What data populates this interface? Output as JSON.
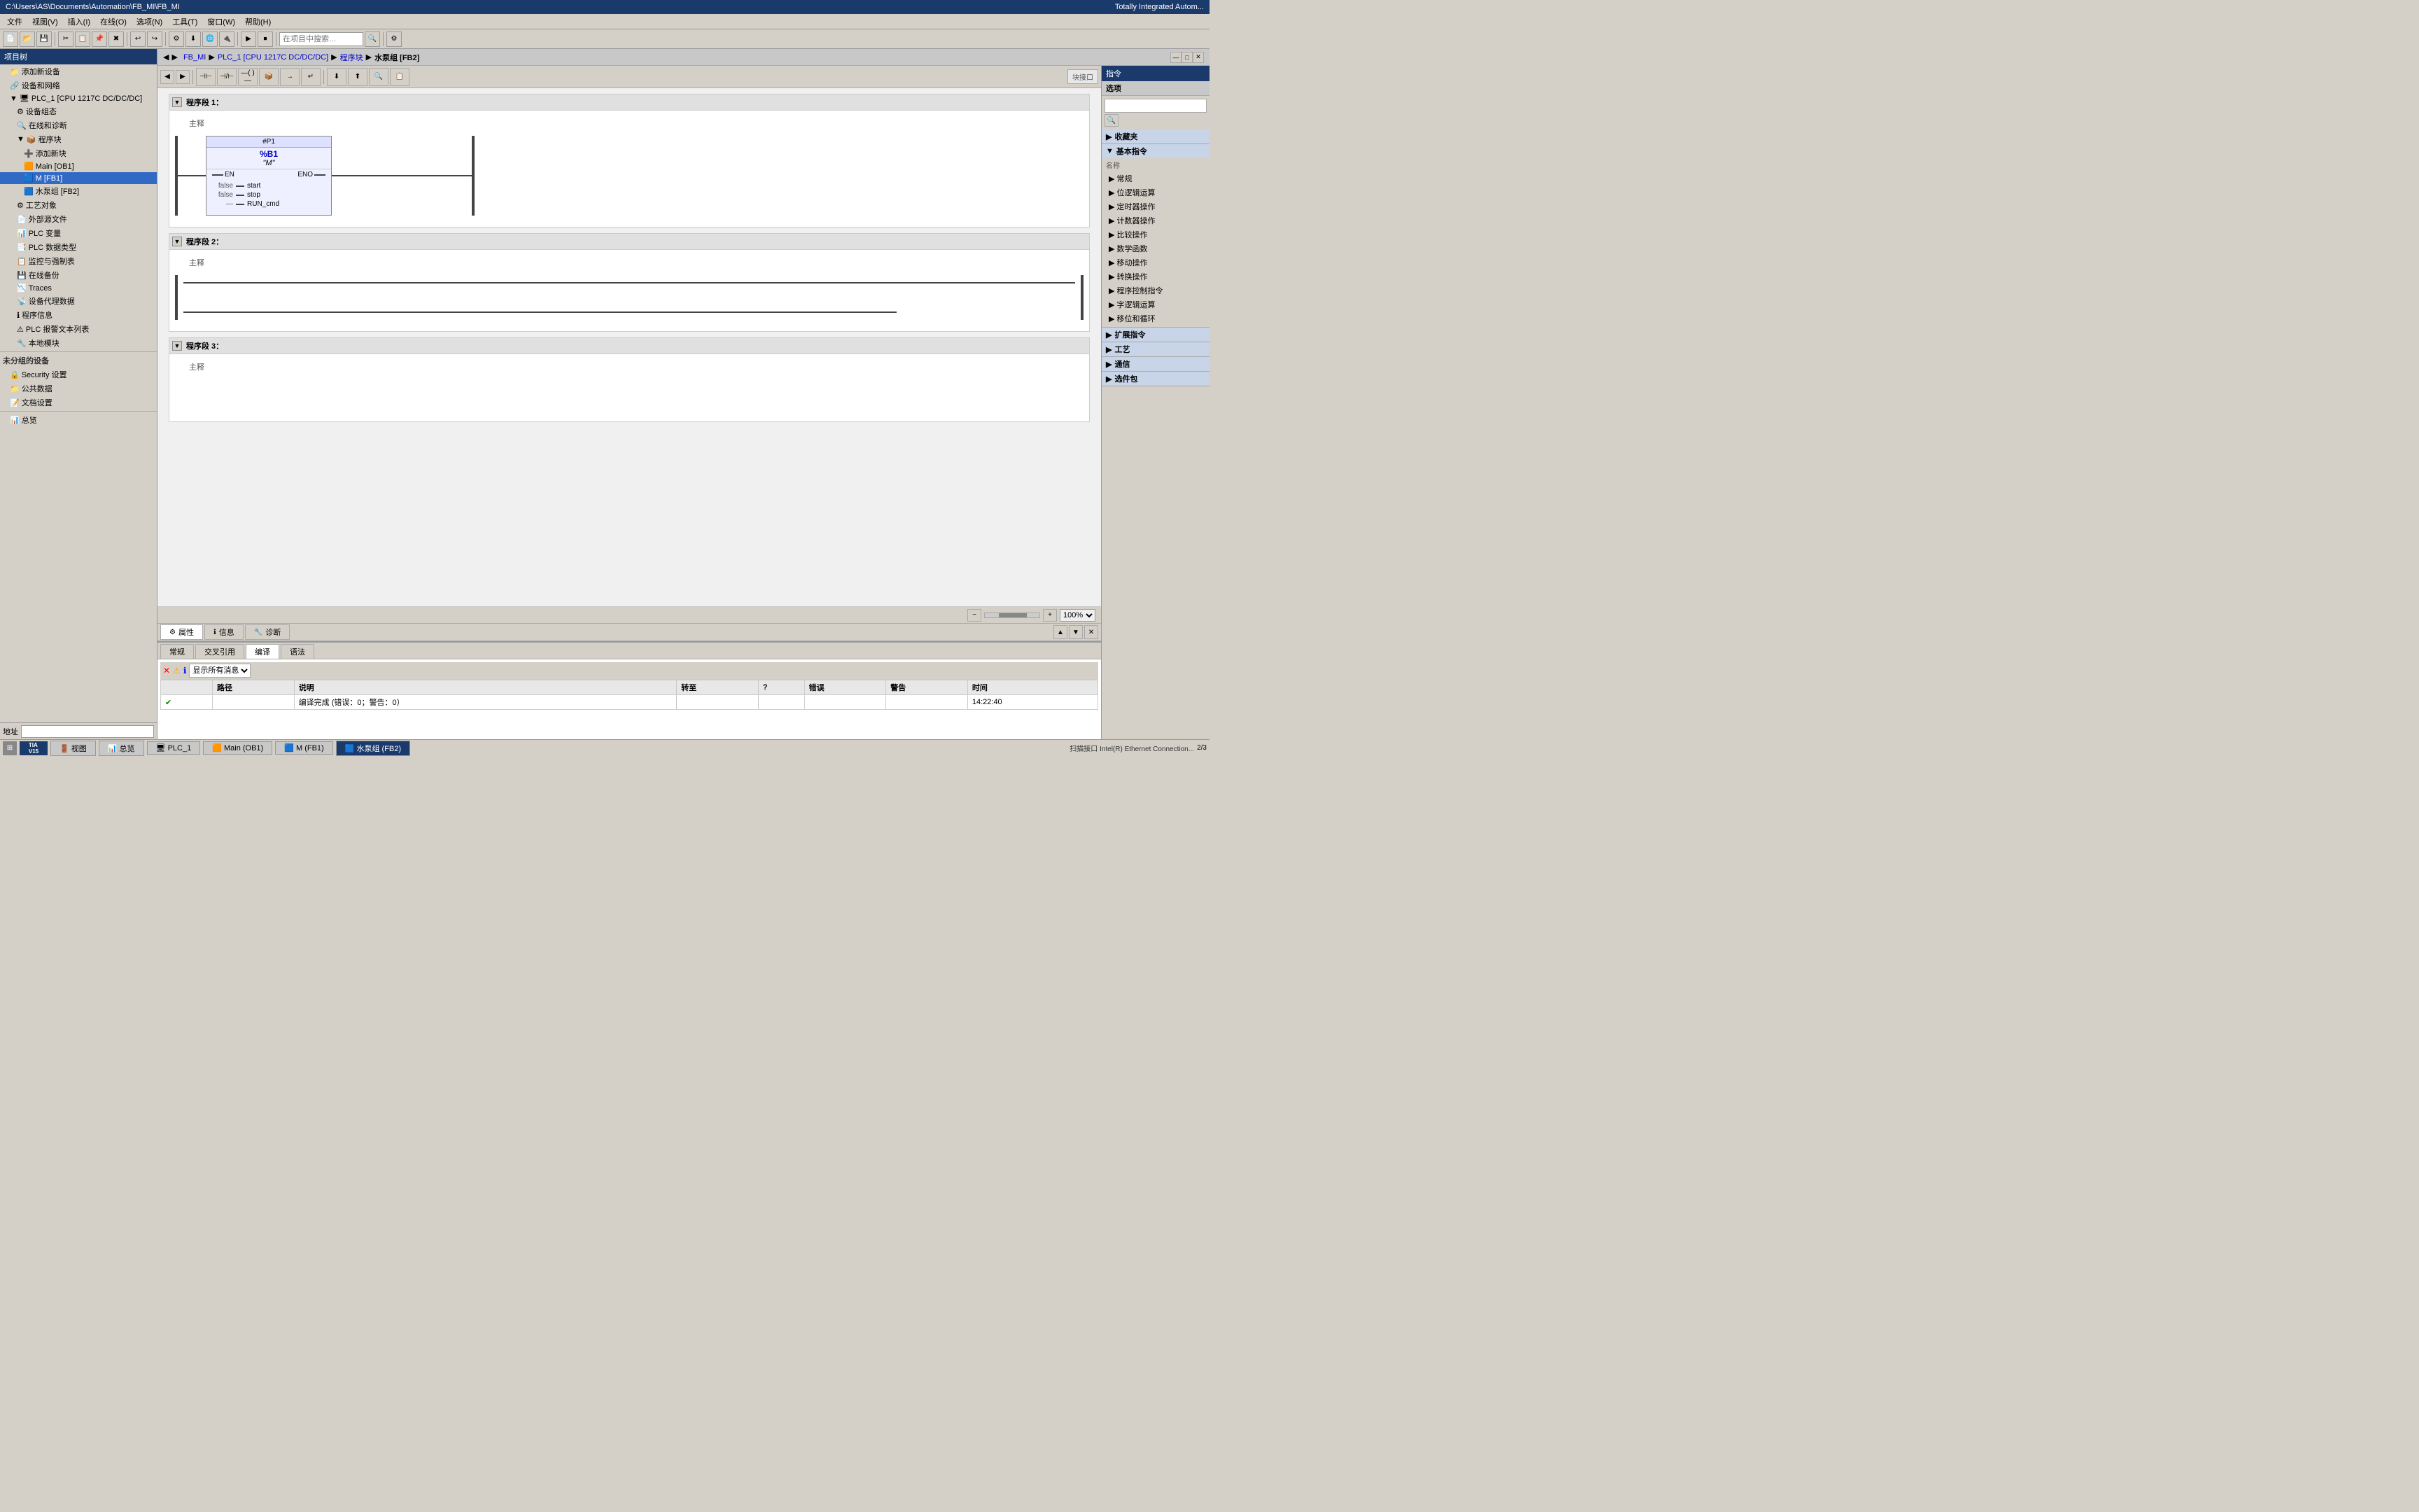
{
  "titleBar": {
    "text": "C:\\Users\\AS\\Documents\\Automation\\FB_MI\\FB_MI",
    "rightText": "Totally Integrated Autom..."
  },
  "menuBar": {
    "items": [
      "文件",
      "视图(V)",
      "插入(I)",
      "在线(O)",
      "选项(N)",
      "工具(T)",
      "窗口(W)",
      "帮助(H)"
    ]
  },
  "toolbar": {
    "searchPlaceholder": "在项目中搜索...",
    "buttons": [
      "💾",
      "📁",
      "✂",
      "📋",
      "🔄",
      "↩",
      "↪",
      "🔧",
      "🔍",
      "⚡",
      "⚡",
      "📊",
      "🔗",
      "🔗",
      "📌",
      "▶",
      "⏹",
      "🔄",
      "📡",
      "📡",
      "🖨",
      "🖥"
    ]
  },
  "breadcrumb": {
    "parts": [
      "FB_MI",
      "PLC_1 [CPU 1217C DC/DC/DC]",
      "程序块",
      "水泵组 [FB2]"
    ]
  },
  "sidebar": {
    "header": "项目",
    "items": [
      {
        "label": "添加新设备",
        "indent": 1
      },
      {
        "label": "设备和网络",
        "indent": 1
      },
      {
        "label": "PLC_1 [CPU 1217C DC/DC/DC]",
        "indent": 1,
        "expanded": true
      },
      {
        "label": "设备组态",
        "indent": 2
      },
      {
        "label": "在线和诊断",
        "indent": 2
      },
      {
        "label": "程序块",
        "indent": 2,
        "expanded": true
      },
      {
        "label": "添加新块",
        "indent": 3
      },
      {
        "label": "Main [OB1]",
        "indent": 3
      },
      {
        "label": "M [FB1]",
        "indent": 3,
        "active": true
      },
      {
        "label": "水泵组 [FB2]",
        "indent": 3
      },
      {
        "label": "工艺对象",
        "indent": 2
      },
      {
        "label": "外部源文件",
        "indent": 2
      },
      {
        "label": "PLC 变量",
        "indent": 2
      },
      {
        "label": "PLC 数据类型",
        "indent": 2
      },
      {
        "label": "监控与强制表",
        "indent": 2
      },
      {
        "label": "在线备份",
        "indent": 2
      },
      {
        "label": "Traces",
        "indent": 2
      },
      {
        "label": "设备代理数据",
        "indent": 2
      },
      {
        "label": "程序信息",
        "indent": 2
      },
      {
        "label": "PLC 报警文本列表",
        "indent": 2
      },
      {
        "label": "本地模块",
        "indent": 2
      }
    ],
    "sectionLabel": "未分组的设备",
    "extraItems": [
      {
        "label": "Security 设置",
        "indent": 1
      },
      {
        "label": "公共数据",
        "indent": 1
      },
      {
        "label": "文档设置",
        "indent": 1
      }
    ],
    "bottomLabel": "总览",
    "addressLabel": "地址"
  },
  "ladderToolbar": {
    "buttons": [
      "⊣⊢",
      "⊣/⊢",
      "—(  )—",
      "📦",
      "→",
      "↵"
    ]
  },
  "segments": [
    {
      "id": 1,
      "title": "程序段 1：",
      "comment": "主释",
      "hasDiagram": true,
      "fbTitle": "#P1",
      "fbName": "%B1",
      "fbInstance": "\"M\"",
      "enLabel": "EN",
      "enoLabel": "ENO",
      "pins": [
        {
          "side": "left",
          "value": "false",
          "name": "start"
        },
        {
          "side": "left",
          "value": "false",
          "name": "stop"
        },
        {
          "side": "left",
          "value": "—",
          "name": "RUN_cmd"
        }
      ]
    },
    {
      "id": 2,
      "title": "程序段 2：",
      "comment": "主释",
      "hasDiagram": false
    },
    {
      "id": 3,
      "title": "程序段 3：",
      "comment": "主释",
      "hasDiagram": false
    }
  ],
  "bottomPanel": {
    "tabs": [
      "常规",
      "交叉引用",
      "编译",
      "语法"
    ],
    "activeTab": "编译",
    "filterLabel": "显示所有消息",
    "columns": [
      "路径",
      "说明",
      "转至",
      "?",
      "错误",
      "警告",
      "时间"
    ],
    "rows": [
      {
        "icon": "✔",
        "path": "",
        "description": "编译完成 (错误：0；警告：0）",
        "goto": "",
        "q": "",
        "errors": "",
        "warnings": "",
        "time": "14:22:40"
      }
    ],
    "summary": "编译完成 (错误：0；警告：0）"
  },
  "statusBar": {
    "tabs": [
      "门视图",
      "总览",
      "PLC_1",
      "Main (OB1)",
      "M (FB1)",
      "水泵组 (FB2)"
    ],
    "activeTab": "水泵组 (FB2)",
    "rightText": "扫描接口 Intel(R) Ethernet Connection..."
  },
  "rightPanel": {
    "header": "指令",
    "subHeader": "选项",
    "searchPlaceholder": "",
    "sections": [
      {
        "label": "收藏夹",
        "expanded": false
      },
      {
        "label": "基本指令",
        "expanded": true,
        "items": [
          {
            "label": "常规"
          },
          {
            "label": "位逻辑运算"
          },
          {
            "label": "定时器操作"
          },
          {
            "label": "计数器操作"
          },
          {
            "label": "比较操作"
          },
          {
            "label": "数学函数"
          },
          {
            "label": "移动操作"
          },
          {
            "label": "转换操作"
          },
          {
            "label": "程序控制指令"
          },
          {
            "label": "字逻辑运算"
          },
          {
            "label": "移位和循环"
          }
        ]
      },
      {
        "label": "扩展指令",
        "expanded": false
      },
      {
        "label": "工艺",
        "expanded": false
      },
      {
        "label": "通信",
        "expanded": false
      },
      {
        "label": "选件包",
        "expanded": false
      }
    ]
  },
  "zoomLevel": "100%",
  "panelTabs": {
    "tabs": [
      {
        "label": "属性",
        "icon": "⚙"
      },
      {
        "label": "信息",
        "icon": "ℹ"
      },
      {
        "label": "诊断",
        "icon": "🔧"
      }
    ],
    "activeTab": "属性"
  }
}
